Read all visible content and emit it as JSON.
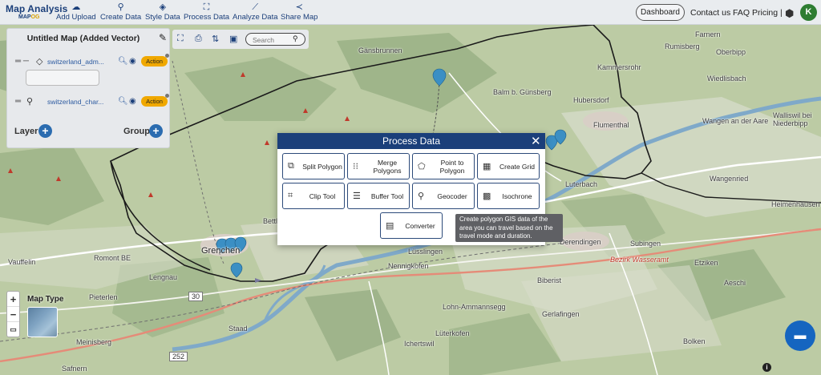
{
  "app": {
    "logo_line1": "Map Analysis",
    "logo_line2_a": "MAP",
    "logo_line2_b": "OG"
  },
  "nav": [
    {
      "label": "Add Upload",
      "icon": "cloud-upload-icon"
    },
    {
      "label": "Create Data",
      "icon": "map-pin-icon"
    },
    {
      "label": "Style Data",
      "icon": "paint-bucket-icon"
    },
    {
      "label": "Process Data",
      "icon": "process-icon"
    },
    {
      "label": "Analyze Data",
      "icon": "analyze-icon"
    },
    {
      "label": "Share Map",
      "icon": "share-icon"
    }
  ],
  "topright": {
    "dashboard": "Dashboard",
    "contact": "Contact us",
    "faq": "FAQ",
    "pricing": "Pricing |",
    "avatar_initial": "K"
  },
  "layerpanel": {
    "title": "Untitled Map (Added Vector)",
    "layers": [
      {
        "name": "switzerland_adm...",
        "action": "Action"
      },
      {
        "name": "switzerland_char...",
        "action": "Action"
      }
    ],
    "layer_label": "Layer",
    "group_label": "Group"
  },
  "maptools": {
    "search_placeholder": "Search"
  },
  "maptype": {
    "label": "Map Type"
  },
  "modal": {
    "title": "Process Data",
    "tools": [
      {
        "label": "Split Polygon",
        "icon": "split-polygon-icon"
      },
      {
        "label": "Merge Polygons",
        "icon": "merge-polygons-icon"
      },
      {
        "label": "Point to Polygon",
        "icon": "point-to-polygon-icon"
      },
      {
        "label": "Create Grid",
        "icon": "grid-icon"
      },
      {
        "label": "Clip Tool",
        "icon": "crop-icon"
      },
      {
        "label": "Buffer Tool",
        "icon": "layers-icon"
      },
      {
        "label": "Geocoder",
        "icon": "geocoder-icon"
      },
      {
        "label": "Isochrone",
        "icon": "isochrone-icon"
      },
      {
        "label": "Converter",
        "icon": "converter-icon"
      }
    ]
  },
  "tooltip": {
    "text": "Create polygon GIS data of the area you can travel based on the travel mode and duration."
  },
  "map": {
    "places": [
      "Farnern",
      "Rumisberg",
      "Oberbipp",
      "Gänsbrunnen",
      "Kammersrohr",
      "Wiedlisbach",
      "Balm b. Günsberg",
      "Hubersdorf",
      "Flumenthal",
      "Wangen an der Aare",
      "Walliswil bei Niederbipp",
      "Wangenried",
      "Luterbach",
      "Heimenhausen",
      "Derendingen",
      "Subingen",
      "Bettlach",
      "Grenchen",
      "Lüsslingen",
      "Nennigkofen",
      "Romont BE",
      "Vauffelin",
      "Lengnau",
      "Pieterlen",
      "Meinisberg",
      "Safnern",
      "Staad",
      "Lohn-Ammannsegg",
      "Biberist",
      "Etziken",
      "Aeschi",
      "Gerlafingen",
      "Lüterkofen",
      "Ichertswil",
      "Bolken",
      "Bezirk Wasseramt"
    ],
    "road_numbers": [
      "30",
      "252"
    ]
  },
  "colors": {
    "brand_navy": "#1b3f7a",
    "action_orange": "#f0a800",
    "plus_blue": "#2b6cb0",
    "chat_blue": "#1565c0",
    "avatar_green": "#2e7d32"
  }
}
